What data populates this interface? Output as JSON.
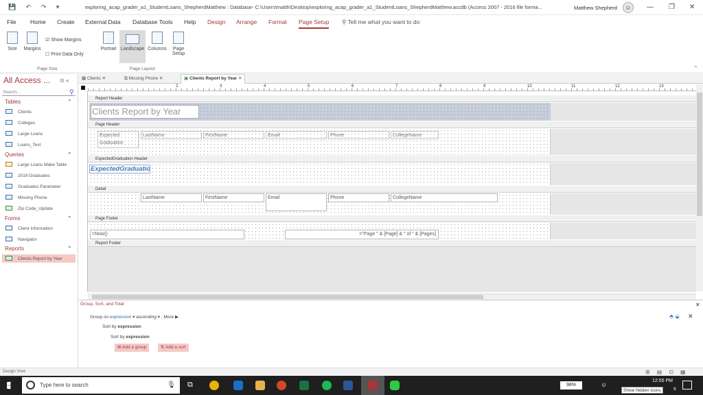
{
  "titlebar": {
    "title": "exploring_acap_grader_a1_StudentLoans_ShepherdMatthew : Database- C:\\Users\\matth\\Desktop\\exploring_acap_grader_a1_StudentLoans_ShepherdMatthew.accdb (Access 2007 - 2016 file forma...",
    "user": "Matthew Shepherd"
  },
  "menu_tabs": [
    "File",
    "Home",
    "Create",
    "External Data",
    "Database Tools",
    "Help",
    "Design",
    "Arrange",
    "Format",
    "Page Setup"
  ],
  "active_tab": "Page Setup",
  "tell_me": "Tell me what you want to do",
  "ribbon": {
    "size": "Size",
    "margins": "Margins",
    "show_margins": "Show Margins",
    "print_data_only": "Print Data Only",
    "portrait": "Portrait",
    "landscape": "Landscape",
    "columns": "Columns",
    "page_setup": "Page Setup",
    "group_page_size": "Page Size",
    "group_page_layout": "Page Layout"
  },
  "nav": {
    "header": "All Access ...",
    "search_placeholder": "Search...",
    "tables_label": "Tables",
    "tables": [
      "Clients",
      "Colleges",
      "Large Loans",
      "Loans_Text"
    ],
    "queries_label": "Queries",
    "queries": [
      "Large Loans Make Table",
      "2019 Graduates",
      "Graduates Parameter",
      "Missing Phone",
      "Zip Code_Update"
    ],
    "forms_label": "Forms",
    "forms": [
      "Client Information",
      "Navigator"
    ],
    "reports_label": "Reports",
    "reports": [
      "Clients Report by Year"
    ]
  },
  "doc_tabs": [
    "Clients",
    "Missing Phone",
    "Clients Report by Year"
  ],
  "ruler_numbers": [
    "1",
    "2",
    "3",
    "4",
    "5",
    "6",
    "7",
    "8",
    "9",
    "10",
    "11",
    "12",
    "13"
  ],
  "report": {
    "report_header": "Report Header",
    "title": "Clients Report by Year",
    "page_header": "Page Header",
    "header_labels": [
      "Expected Graduation",
      "LastName",
      "FirstName",
      "Email",
      "Phone",
      "CollegeName"
    ],
    "group_header": "ExpectedGraduation Header",
    "group_field": "ExpectedGraduatio",
    "detail": "Detail",
    "detail_fields": [
      "LastName",
      "FirstName",
      "Email",
      "Phone",
      "CollegeName"
    ],
    "page_footer": "Page Footer",
    "now_field": "=Now()",
    "page_field": "=\"Page \" & [Page] & \" of \" & [Pages]",
    "report_footer": "Report Footer"
  },
  "group_sort": {
    "title": "Group, Sort, and Total",
    "group_on": "Group on",
    "expression": "expression",
    "ascending": "ascending",
    "more": "More",
    "sort_by": "Sort by",
    "add_group": "Add a group",
    "add_sort": "Add a sort"
  },
  "status": {
    "view": "Design View"
  },
  "taskbar": {
    "search": "Type here to search",
    "battery": "98%",
    "time": "12:55 PM",
    "tooltip": "Show hidden icons",
    "notification_count": "9"
  }
}
